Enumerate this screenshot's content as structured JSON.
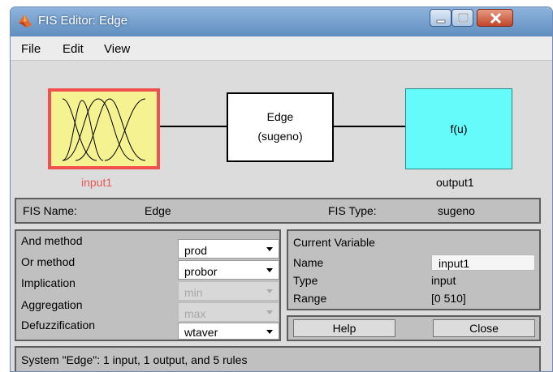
{
  "window": {
    "title": "FIS Editor: Edge"
  },
  "menu": {
    "items": [
      "File",
      "Edit",
      "View"
    ]
  },
  "diagram": {
    "input_label": "input1",
    "fis_name": "Edge",
    "fis_type": "(sugeno)",
    "output_function": "f(u)",
    "output_label": "output1"
  },
  "info": {
    "fis_name_label": "FIS Name:",
    "fis_name_value": "Edge",
    "fis_type_label": "FIS Type:",
    "fis_type_value": "sugeno"
  },
  "methods": {
    "and_label": "And method",
    "and_value": "prod",
    "or_label": "Or method",
    "or_value": "probor",
    "implication_label": "Implication",
    "implication_value": "min",
    "aggregation_label": "Aggregation",
    "aggregation_value": "max",
    "defuzz_label": "Defuzzification",
    "defuzz_value": "wtaver"
  },
  "current_variable": {
    "header": "Current Variable",
    "name_label": "Name",
    "name_value": "input1",
    "type_label": "Type",
    "type_value": "input",
    "range_label": "Range",
    "range_value": "[0 510]"
  },
  "buttons": {
    "help": "Help",
    "close": "Close"
  },
  "status": {
    "text": "System \"Edge\": 1 input, 1 output, and 5 rules"
  },
  "colors": {
    "input_fill": "#f4f291",
    "input_border": "#f0504e",
    "output_fill": "#66fbfb",
    "panel": "#c0c0c0"
  },
  "icons": [
    "matlab-logo-icon",
    "minimize-icon",
    "maximize-icon",
    "close-icon",
    "membership-functions-icon",
    "dropdown-arrow-icon"
  ]
}
